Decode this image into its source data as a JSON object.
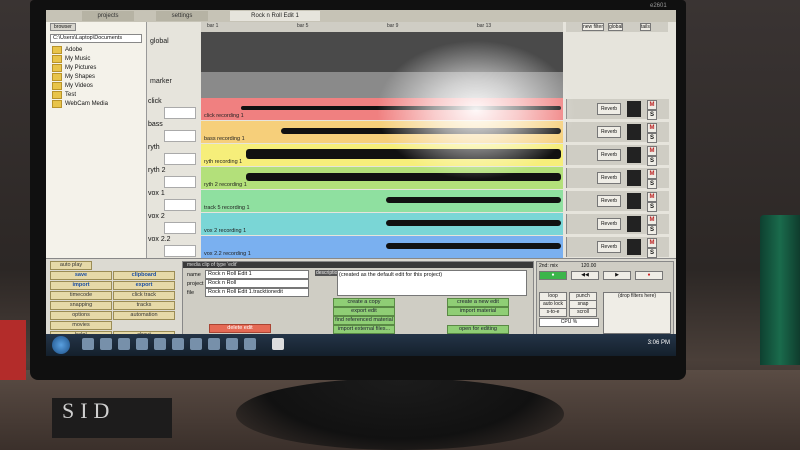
{
  "tabs": {
    "projects": "projects",
    "settings": "settings",
    "edit": "Rock n Roll Edit 1",
    "edit_id": "e2601"
  },
  "browser": {
    "button": "browser",
    "path": "C:\\Users\\Laptop\\Documents",
    "folders": [
      "Adobe",
      "My Music",
      "My Pictures",
      "My Shapes",
      "My Videos",
      "Test",
      "WebCam Media"
    ]
  },
  "timeline": {
    "bars": [
      "bar 1",
      "bar 5",
      "bar 9",
      "bar 13"
    ],
    "global_label": "global",
    "marker_label": "marker",
    "header_buttons": {
      "new_filter": "new filter",
      "global": "global",
      "marker": "marker",
      "tails": "tails",
      "dry": "dry"
    }
  },
  "tracks": [
    {
      "name": "click",
      "clip": "click recording 1",
      "color": "#f08080",
      "plugin": "Reverb"
    },
    {
      "name": "bass",
      "clip": "bass recording 1",
      "color": "#f6cf7a",
      "plugin": "Reverb"
    },
    {
      "name": "ryth",
      "clip": "ryth recording 1",
      "color": "#f6ee7a",
      "plugin": "Reverb"
    },
    {
      "name": "ryth 2",
      "clip": "ryth 2 recording 1",
      "color": "#b3e07a",
      "plugin": "Reverb"
    },
    {
      "name": "vox 1",
      "clip": "track 5 recording 1",
      "color": "#8fe0a0",
      "plugin": "Reverb"
    },
    {
      "name": "vox 2",
      "clip": "vox 2 recording 1",
      "color": "#7ad6d6",
      "plugin": "Reverb"
    },
    {
      "name": "vox 2.2",
      "clip": "vox 2.2 recording 1",
      "color": "#7ab0f0",
      "plugin": "Reverb"
    }
  ],
  "left_buttons": {
    "auto_play": "auto play",
    "rows": [
      [
        "save",
        "clipboard"
      ],
      [
        "import",
        "export"
      ],
      [
        "timecode",
        "click track"
      ],
      [
        "snapping",
        "tracks"
      ],
      [
        "options",
        "automation"
      ],
      [
        "movies",
        ""
      ],
      [
        "help!",
        "about"
      ]
    ]
  },
  "inspector": {
    "title": "media clip of type 'edit'",
    "name_label": "name",
    "name_value": "Rock n Roll Edit 1",
    "project_label": "project",
    "project_value": "Rock n Roll",
    "file_label": "file",
    "file_value": "Rock n Roll Edit 1.tracktionedit",
    "description_label": "description",
    "description_value": "(created as the default edit for this project)",
    "buttons": [
      "create a copy",
      "export edit",
      "find referenced material",
      "import external files...",
      "create a new edit",
      "import material",
      "open for editing"
    ],
    "delete": "delete edit"
  },
  "transport": {
    "position": "2nd: mix",
    "tempo": "120.00",
    "buttons": [
      "loop",
      "punch",
      "auto lock",
      "snap",
      "s-to-e",
      "scroll"
    ],
    "cpu": "CPU %",
    "filters_hint": "(drop filters here)"
  },
  "taskbar": {
    "clock": "3:06 PM"
  }
}
